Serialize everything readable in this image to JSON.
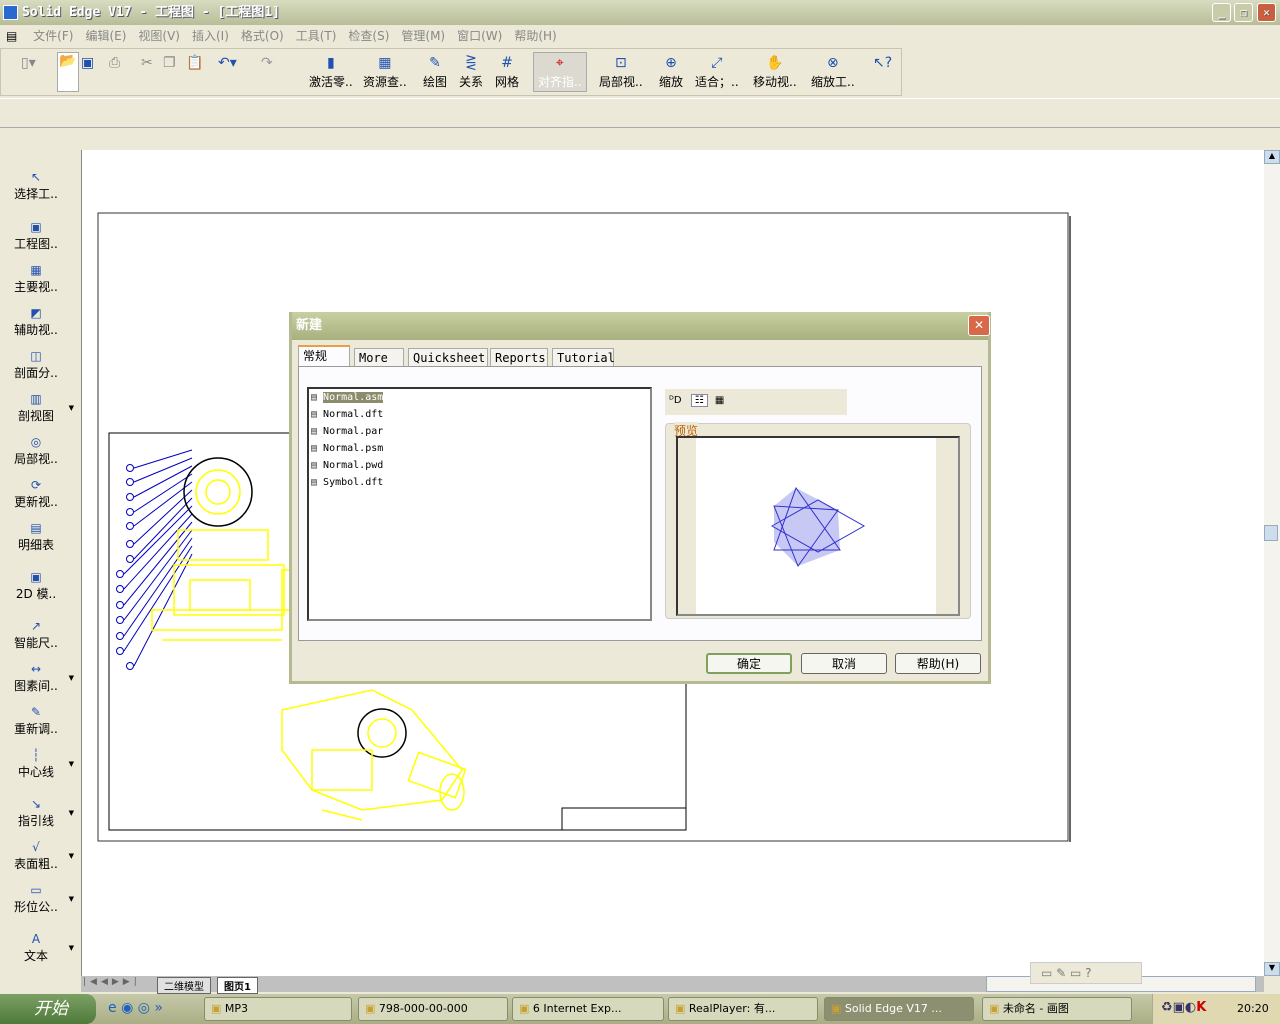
{
  "window": {
    "title": "Solid Edge V17 - 工程图 - [工程图1]",
    "minimize": "_",
    "restore": "❐",
    "close": "✕"
  },
  "menu": [
    "文件(F)",
    "编辑(E)",
    "视图(V)",
    "插入(I)",
    "格式(O)",
    "工具(T)",
    "检查(S)",
    "管理(M)",
    "窗口(W)",
    "帮助(H)"
  ],
  "toolbar": {
    "buttons": [
      {
        "label": "激活零..",
        "icon": "activate-part-icon"
      },
      {
        "label": "资源查..",
        "icon": "library-icon"
      },
      {
        "label": "绘图",
        "icon": "draw-icon"
      },
      {
        "label": "关系",
        "icon": "relations-icon"
      },
      {
        "label": "网格",
        "icon": "grid-icon"
      },
      {
        "label": "对齐指..",
        "icon": "align-icon"
      },
      {
        "label": "局部视..",
        "icon": "zoom-area-icon"
      },
      {
        "label": "缩放",
        "icon": "zoom-icon"
      },
      {
        "label": "适合；..",
        "icon": "fit-icon"
      },
      {
        "label": "移动视..",
        "icon": "pan-icon"
      },
      {
        "label": "缩放工..",
        "icon": "zoom-tool-icon"
      }
    ]
  },
  "leftbar": [
    {
      "label": "选择工..",
      "icon": "↖"
    },
    {
      "label": "工程图..",
      "icon": "▣"
    },
    {
      "label": "主要视..",
      "icon": "▦"
    },
    {
      "label": "辅助视..",
      "icon": "◩"
    },
    {
      "label": "剖面分..",
      "icon": "◫"
    },
    {
      "label": "剖视图",
      "icon": "▥",
      "dd": true
    },
    {
      "label": "局部视..",
      "icon": "◎"
    },
    {
      "label": "更新视..",
      "icon": "⟳"
    },
    {
      "label": "明细表",
      "icon": "▤"
    },
    {
      "label": "2D 模..",
      "icon": "▣"
    },
    {
      "label": "智能尺..",
      "icon": "↗"
    },
    {
      "label": "图素间..",
      "icon": "↔",
      "dd": true
    },
    {
      "label": "重新调..",
      "icon": "✎"
    },
    {
      "label": "中心线",
      "icon": "┆",
      "dd": true
    },
    {
      "label": "指引线",
      "icon": "↘",
      "dd": true
    },
    {
      "label": "表面粗..",
      "icon": "√",
      "dd": true
    },
    {
      "label": "形位公..",
      "icon": "▭",
      "dd": true
    },
    {
      "label": "文本",
      "icon": "A",
      "dd": true
    }
  ],
  "sheet_tabs": [
    "二维模型",
    "图页1"
  ],
  "dialog": {
    "title": "新建",
    "tabs": [
      "常规",
      "More",
      "Quicksheet",
      "Reports",
      "Tutorial"
    ],
    "files": [
      "Normal.asm",
      "Normal.dft",
      "Normal.par",
      "Normal.psm",
      "Normal.pwd",
      "Symbol.dft"
    ],
    "selected": "Normal.asm",
    "preview_label": "预览",
    "ok": "确定",
    "cancel": "取消",
    "help": "帮助(H)"
  },
  "taskbar": {
    "start": "开始",
    "tasks": [
      "MP3",
      "798-000-00-000",
      "6 Internet Exp...",
      "RealPlayer: 有...",
      "Solid Edge V17 ...",
      "未命名 - 画图"
    ],
    "active": "Solid Edge V17 ...",
    "clock": "20:20"
  },
  "colors": {
    "drawing": "#ffff00",
    "balloon": "#0000c0",
    "preview": "#3030d0"
  }
}
